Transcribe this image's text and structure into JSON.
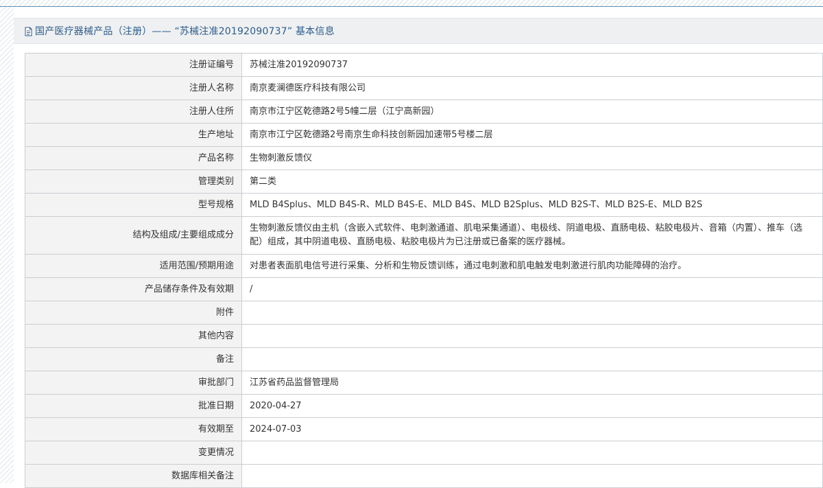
{
  "page": {
    "title": "国产医疗器械产品（注册）——  “苏械注准20192090737”  基本信息"
  },
  "rows": [
    {
      "label": "注册证编号",
      "value": "苏械注准20192090737"
    },
    {
      "label": "注册人名称",
      "value": "南京麦澜德医疗科技有限公司"
    },
    {
      "label": "注册人住所",
      "value": "南京市江宁区乾德路2号5幢二层（江宁高新园）"
    },
    {
      "label": "生产地址",
      "value": "南京市江宁区乾德路2号南京生命科技创新园加速带5号楼二层"
    },
    {
      "label": "产品名称",
      "value": "生物刺激反馈仪"
    },
    {
      "label": "管理类别",
      "value": "第二类"
    },
    {
      "label": "型号规格",
      "value": "MLD B4Splus、MLD B4S-R、MLD B4S-E、MLD B4S、MLD B2Splus、MLD B2S-T、MLD B2S-E、MLD B2S"
    },
    {
      "label": "结构及组成/主要组成成分",
      "value": "生物刺激反馈仪由主机（含嵌入式软件、电刺激通道、肌电采集通道）、电极线、阴道电极、直肠电极、粘胶电极片、音箱（内置）、推车（选配）组成，其中阴道电极、直肠电极、粘胶电极片为已注册或已备案的医疗器械。",
      "tall": true
    },
    {
      "label": "适用范围/预期用途",
      "value": "对患者表面肌电信号进行采集、分析和生物反馈训练，通过电刺激和肌电触发电刺激进行肌肉功能障碍的治疗。"
    },
    {
      "label": "产品储存条件及有效期",
      "value": "/"
    },
    {
      "label": "附件",
      "value": ""
    },
    {
      "label": "其他内容",
      "value": ""
    },
    {
      "label": "备注",
      "value": ""
    },
    {
      "label": "审批部门",
      "value": "江苏省药品监督管理局"
    },
    {
      "label": "批准日期",
      "value": "2020-04-27"
    },
    {
      "label": "有效期至",
      "value": "2024-07-03"
    },
    {
      "label": "变更情况",
      "value": ""
    },
    {
      "label": "数据库相关备注",
      "value": ""
    }
  ],
  "colors": {
    "title": "#2d5c8a",
    "label_bg": "#f3f3f3",
    "border": "#c9cdd2"
  },
  "icons": {
    "title_icon": "document-icon"
  }
}
